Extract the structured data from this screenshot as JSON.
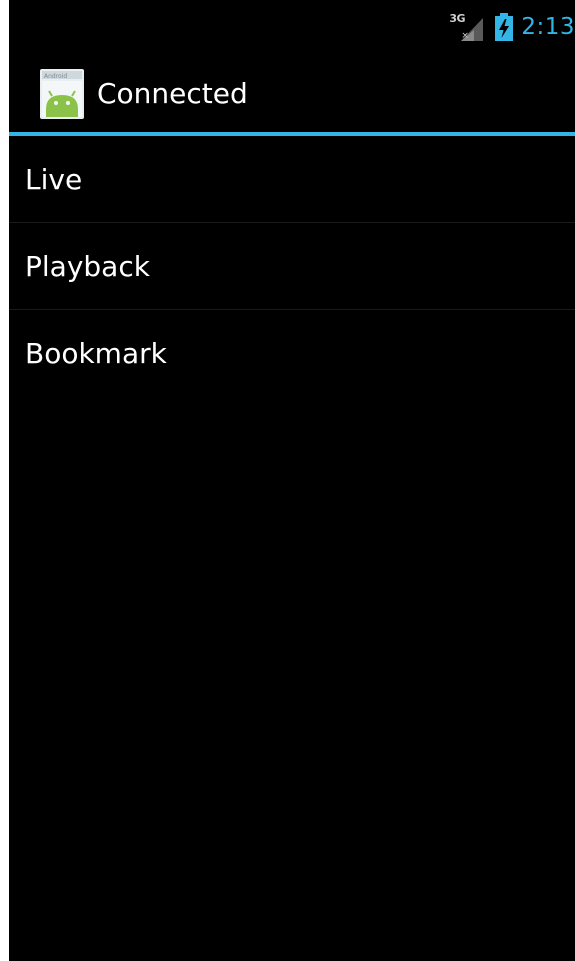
{
  "status_bar": {
    "network_label": "3G",
    "network_status_mark": "×",
    "time": "2:13",
    "icons": [
      "signal-3g-no-data-icon",
      "battery-charging-icon"
    ],
    "accent_color": "#33b5e5"
  },
  "action_bar": {
    "title": "Connected",
    "app_icon": "android-app-icon",
    "app_icon_text": "Android",
    "divider_color": "#33b5e5"
  },
  "menu": {
    "items": [
      {
        "label": "Live"
      },
      {
        "label": "Playback"
      },
      {
        "label": "Bookmark"
      }
    ]
  }
}
